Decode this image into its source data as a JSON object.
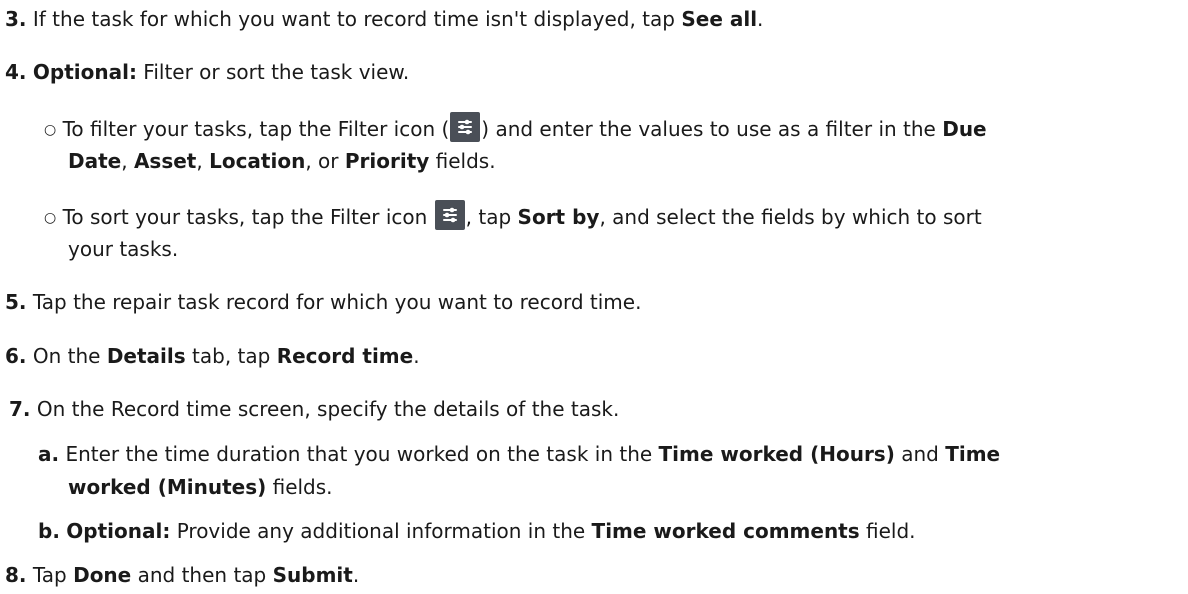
{
  "steps": {
    "s3": {
      "num": "3.",
      "text": " If the task for which you want to record time isn't displayed, tap ",
      "b1": "See all",
      "end": "."
    },
    "s4": {
      "num": "4.",
      "b1": "Optional:",
      "text": "  Filter or sort the task view.",
      "sub1": {
        "marker": "○",
        "t1": "To filter your tasks, tap the Filter icon (",
        "t2": ") and enter the values to use as a filter in the ",
        "b1": "Due",
        "b2": "Date",
        "t3": ", ",
        "b3": "Asset",
        "t4": ", ",
        "b4": "Location",
        "t5": ", or ",
        "b5": "Priority",
        "t6": " fields."
      },
      "sub2": {
        "marker": "○",
        "t1": "To sort your tasks, tap the Filter icon ",
        "t2": ", tap ",
        "b1": "Sort by",
        "t3": ", and select the fields by which to sort",
        "t4": "your tasks."
      }
    },
    "s5": {
      "num": "5.",
      "text": " Tap the repair task record for which you want to record time."
    },
    "s6": {
      "num": "6.",
      "t1": " On the ",
      "b1": "Details",
      "t2": " tab, tap ",
      "b2": "Record time",
      "end": "."
    },
    "s7": {
      "num": "7.",
      "text": " On the Record time screen, specify the details of the task.",
      "a": {
        "num": "a.",
        "t1": " Enter the time duration that you worked on the task in the ",
        "b1": "Time worked (Hours)",
        "t2": " and ",
        "b2": "Time",
        "b3": "worked (Minutes)",
        "t3": " fields."
      },
      "b": {
        "num": "b.",
        "b1": "Optional:",
        "t1": "  Provide any additional information in the ",
        "b2": "Time worked comments",
        "t2": " field."
      }
    },
    "s8": {
      "num": "8.",
      "t1": " Tap ",
      "b1": "Done",
      "t2": " and then tap ",
      "b2": "Submit",
      "end": "."
    }
  },
  "icons": {
    "filter": "filter-sliders-icon",
    "bullet": "hollow-circle-bullet"
  },
  "colors": {
    "text": "#1a1a1a",
    "icon_bg": "#4a4f57",
    "icon_fg": "#ffffff"
  }
}
